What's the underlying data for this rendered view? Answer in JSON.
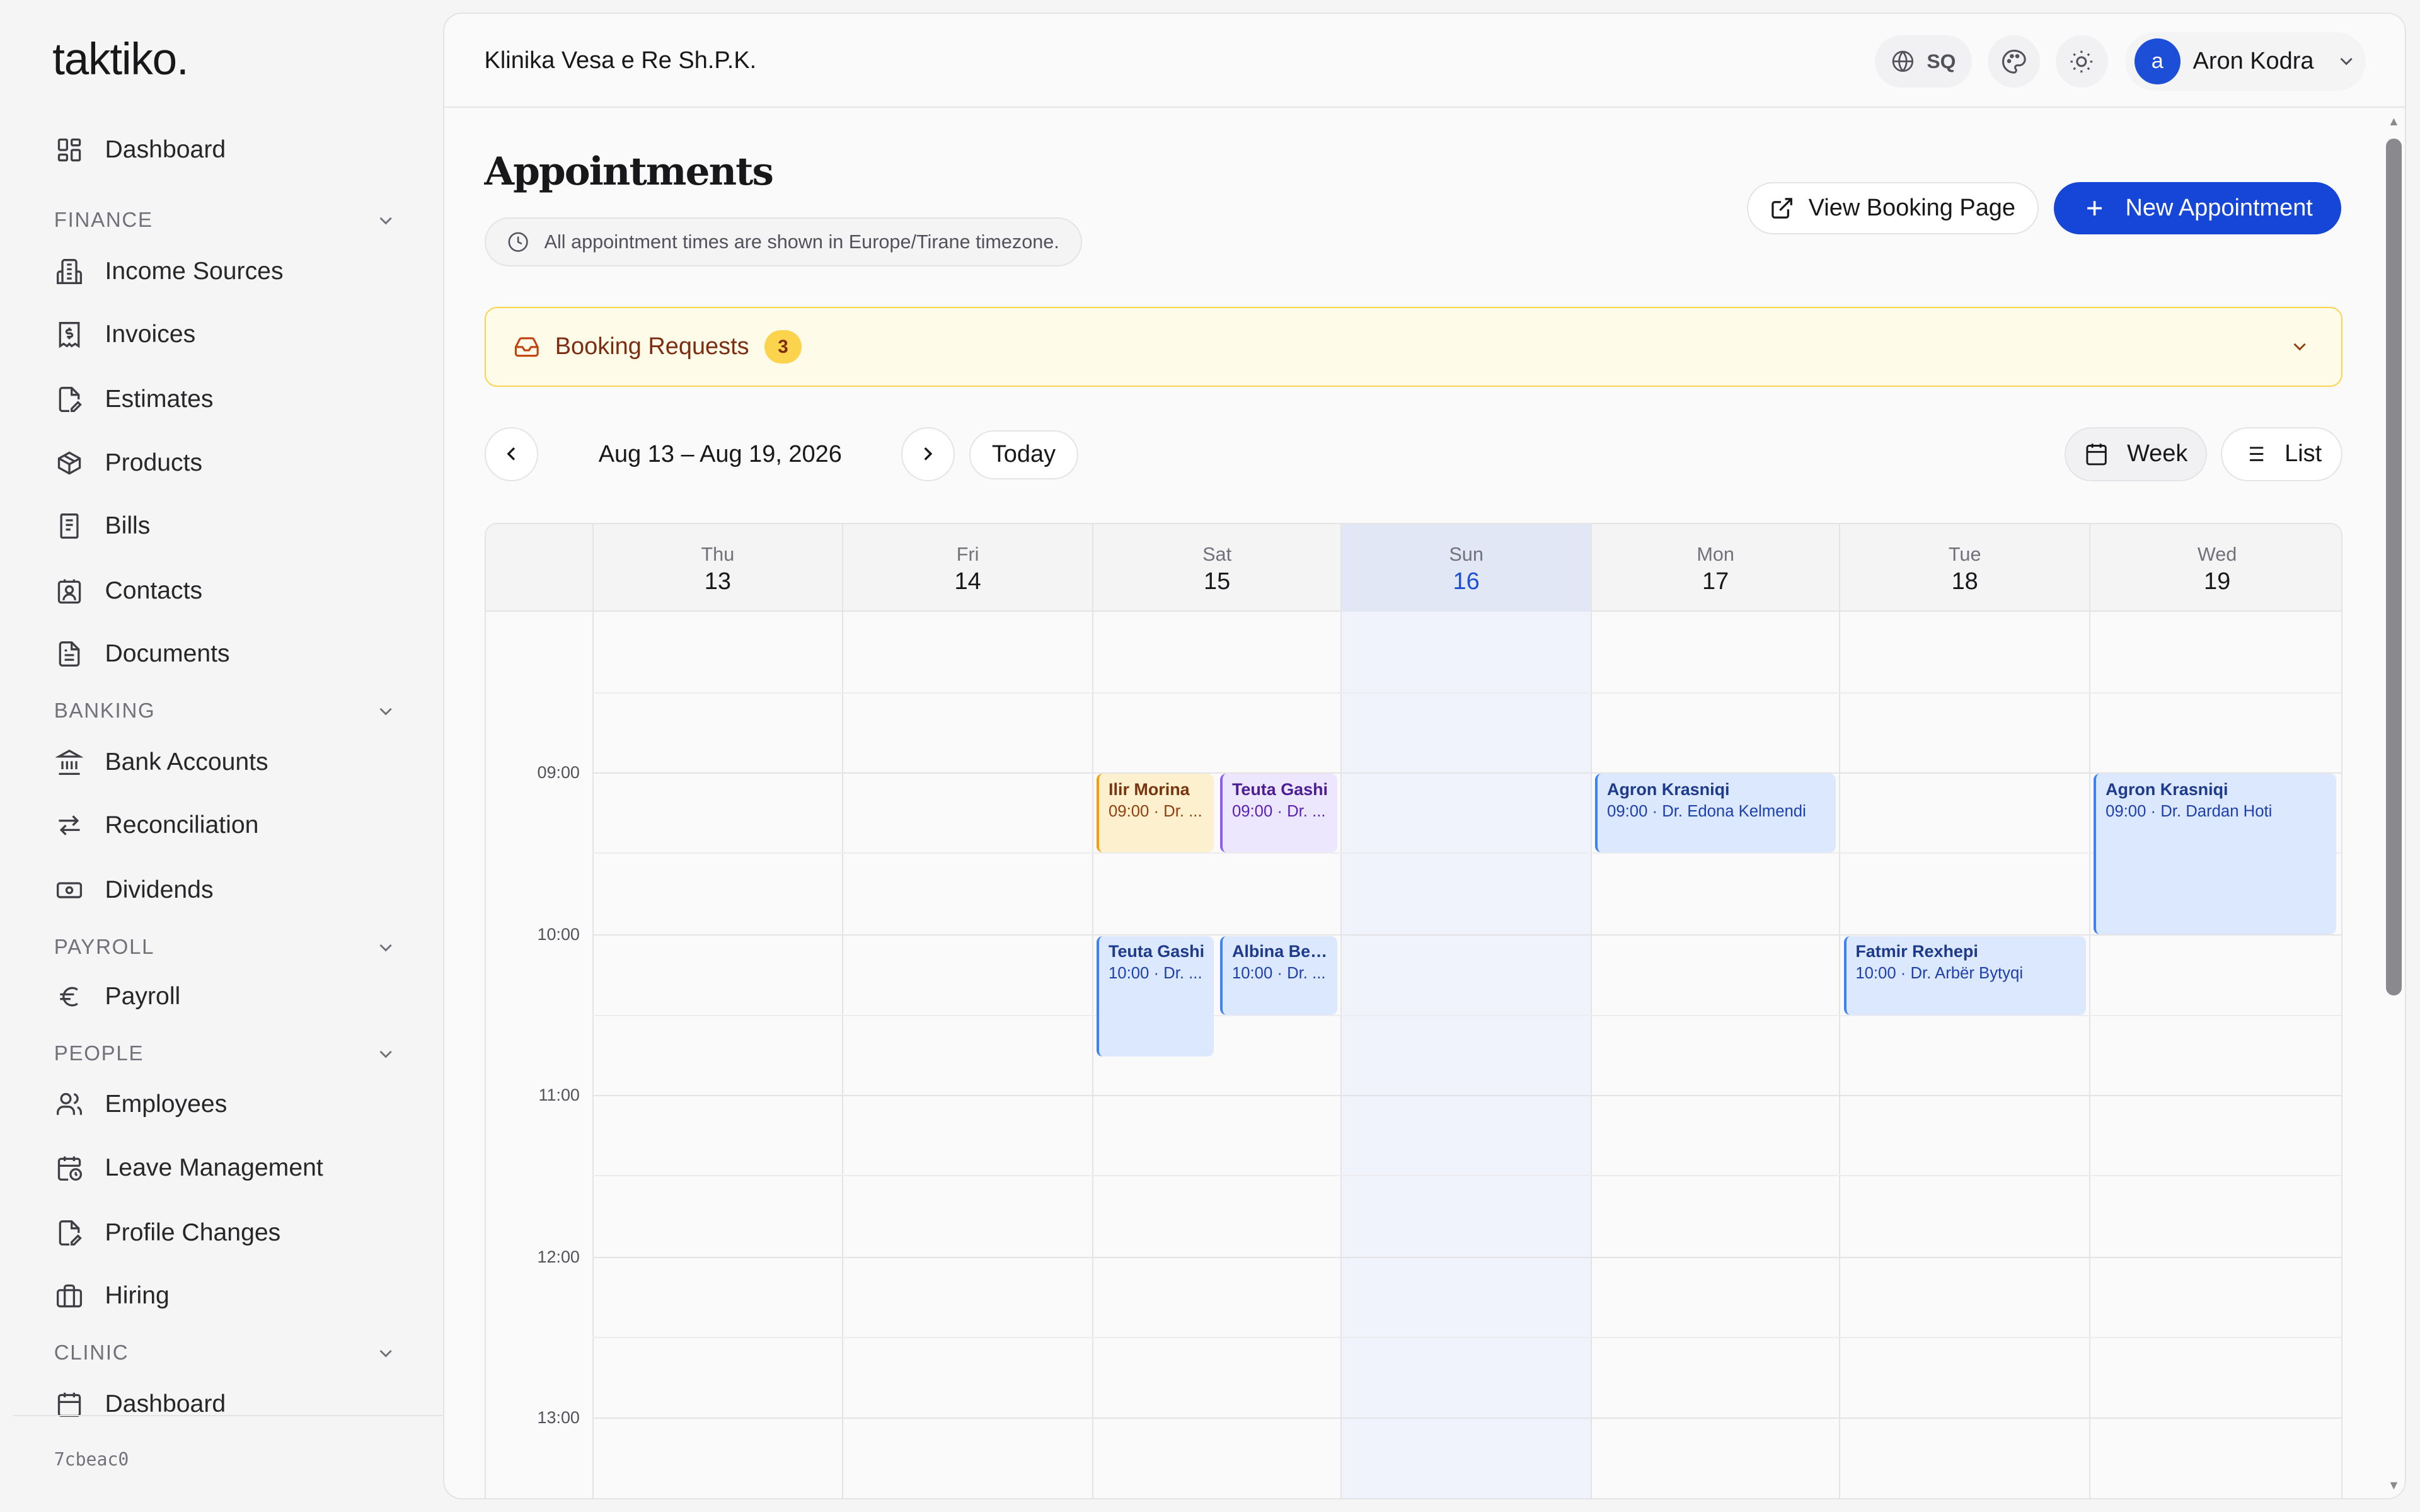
{
  "app": {
    "logo": "taktiko.",
    "version": "7cbeac0"
  },
  "sidebar": {
    "dashboard": "Dashboard",
    "finance": {
      "label": "FINANCE",
      "items": [
        "Income Sources",
        "Invoices",
        "Estimates",
        "Products",
        "Bills",
        "Contacts",
        "Documents"
      ]
    },
    "banking": {
      "label": "BANKING",
      "items": [
        "Bank Accounts",
        "Reconciliation",
        "Dividends"
      ]
    },
    "payroll": {
      "label": "PAYROLL",
      "items": [
        "Payroll"
      ]
    },
    "people": {
      "label": "PEOPLE",
      "items": [
        "Employees",
        "Leave Management",
        "Profile Changes",
        "Hiring"
      ]
    },
    "clinic": {
      "label": "CLINIC",
      "items": [
        "Dashboard"
      ]
    }
  },
  "header": {
    "org": "Klinika Vesa e Re Sh.P.K.",
    "language": "SQ",
    "user": {
      "initial": "a",
      "name": "Aron Kodra"
    }
  },
  "page": {
    "title": "Appointments",
    "timezone_note": "All appointment times are shown in Europe/Tirane timezone.",
    "view_booking_label": "View Booking Page",
    "new_appointment_label": "New Appointment"
  },
  "booking_requests": {
    "label": "Booking Requests",
    "count": "3"
  },
  "toolbar": {
    "date_range": "Aug 13 – Aug 19, 2026",
    "today_label": "Today",
    "week_label": "Week",
    "list_label": "List",
    "active_view": "week"
  },
  "calendar": {
    "days": [
      {
        "name": "Thu",
        "num": "13"
      },
      {
        "name": "Fri",
        "num": "14"
      },
      {
        "name": "Sat",
        "num": "15"
      },
      {
        "name": "Sun",
        "num": "16",
        "today": true
      },
      {
        "name": "Mon",
        "num": "17"
      },
      {
        "name": "Tue",
        "num": "18"
      },
      {
        "name": "Wed",
        "num": "19"
      }
    ],
    "times": [
      "09:00",
      "10:00",
      "11:00",
      "12:00",
      "13:00"
    ],
    "appointments": [
      {
        "name": "Ilir Morina",
        "detail": "09:00 · Dr. ...",
        "color": "orange"
      },
      {
        "name": "Teuta Gashi",
        "detail": "09:00 · Dr. ...",
        "color": "purple"
      },
      {
        "name": "Teuta Gashi",
        "detail": "10:00 · Dr. ...",
        "color": "blue"
      },
      {
        "name": "Albina Beri...",
        "detail": "10:00 · Dr. ...",
        "color": "blue"
      },
      {
        "name": "Agron Krasniqi",
        "detail": "09:00 · Dr. Edona Kelmendi",
        "color": "blue"
      },
      {
        "name": "Fatmir Rexhepi",
        "detail": "10:00 · Dr. Arbër Bytyqi",
        "color": "blue"
      },
      {
        "name": "Agron Krasniqi",
        "detail": "09:00 · Dr. Dardan Hoti",
        "color": "blue"
      }
    ]
  },
  "colors": {
    "primary": "#1546d8",
    "today_bg": "#f0f3fb",
    "warning_bg": "#fefbe8",
    "warning_border": "#fcd34d"
  },
  "icons": {
    "globe": "globe-icon",
    "palette": "palette-icon",
    "theme": "sun-icon",
    "chevron": "chevron-down-icon",
    "clock": "clock-icon",
    "external": "external-link-icon",
    "plus": "plus-icon",
    "inbox": "inbox-icon",
    "calendar": "calendar-icon",
    "list": "list-icon"
  }
}
